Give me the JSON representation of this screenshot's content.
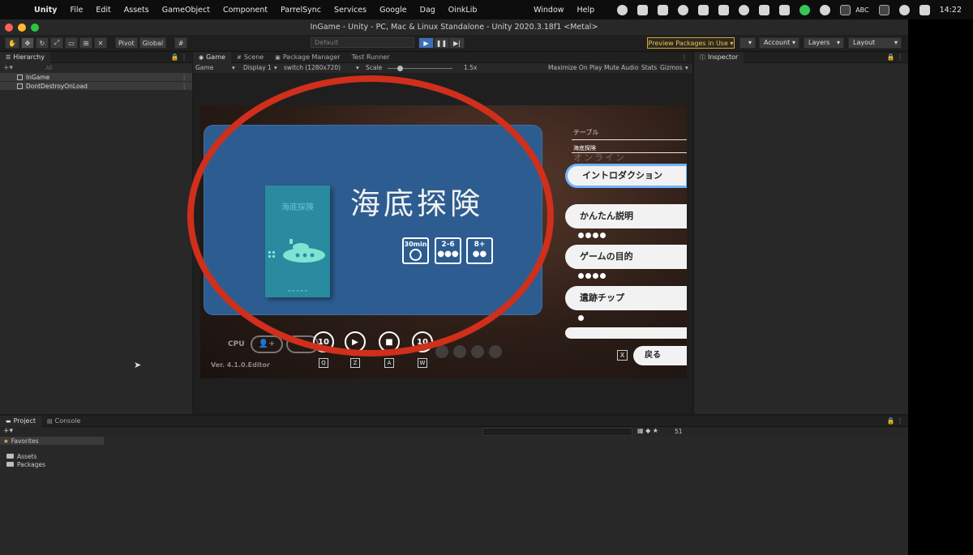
{
  "menubar": {
    "app": "Unity",
    "items": [
      "File",
      "Edit",
      "Assets",
      "GameObject",
      "Component",
      "ParrelSync",
      "Services",
      "Google",
      "Dag",
      "OinkLib"
    ],
    "right_items": [
      "Window",
      "Help"
    ],
    "input_source": "ABC",
    "time": "14:22"
  },
  "window": {
    "title": "InGame - Unity - PC, Mac & Linux Standalone - Unity 2020.3.18f1 <Metal>"
  },
  "toolbar": {
    "pivot": "Pivot",
    "global": "Global",
    "layout_default": "Default",
    "preview": "Preview Packages in Use",
    "account": "Account",
    "layers": "Layers",
    "layout": "Layout"
  },
  "hierarchy": {
    "tab": "Hierarchy",
    "search": "All",
    "rows": [
      "InGame",
      "DontDestroyOnLoad"
    ]
  },
  "game": {
    "tabs": [
      "Game",
      "Scene",
      "Package Manager",
      "Test Runner"
    ],
    "toolbar": {
      "view": "Game",
      "display": "Display 1",
      "resolution": "switch (1280x720)",
      "scale_label": "Scale",
      "scale_value": "1.5x",
      "maximize": "Maximize On Play",
      "mute": "Mute Audio",
      "stats": "Stats",
      "gizmos": "Gizmos"
    }
  },
  "inspector": {
    "tab": "Inspector"
  },
  "project": {
    "tabs": [
      "Project",
      "Console"
    ],
    "favorites": "Favorites",
    "folders": [
      "Assets",
      "Packages"
    ],
    "hidden_count": "51"
  },
  "scene": {
    "box_title": "海底探険",
    "game_title": "海底探険",
    "badges": [
      "30min",
      "2-6",
      "8+"
    ],
    "table_label": "テーブル",
    "selected_label": "海底探険",
    "ghost_label": "オンライン",
    "menu": [
      {
        "label": "イントロダクション",
        "pips": 0
      },
      {
        "label": "かんたん説明",
        "pips": 4
      },
      {
        "label": "ゲームの目的",
        "pips": 4
      },
      {
        "label": "遺跡チップ",
        "pips": 1
      }
    ],
    "cpu_label": "CPU",
    "controls": [
      "10",
      "",
      "",
      "10"
    ],
    "keys": [
      "Q",
      "Z",
      "A",
      "W"
    ],
    "version": "Ver. 4.1.0.Editor",
    "back_key": "X",
    "back": "戻る"
  },
  "colors": {
    "banner": "#2d5d90",
    "annotation": "#cf2f1b",
    "preview_accent": "#f2c14e",
    "play_active": "#3c6fb8"
  }
}
